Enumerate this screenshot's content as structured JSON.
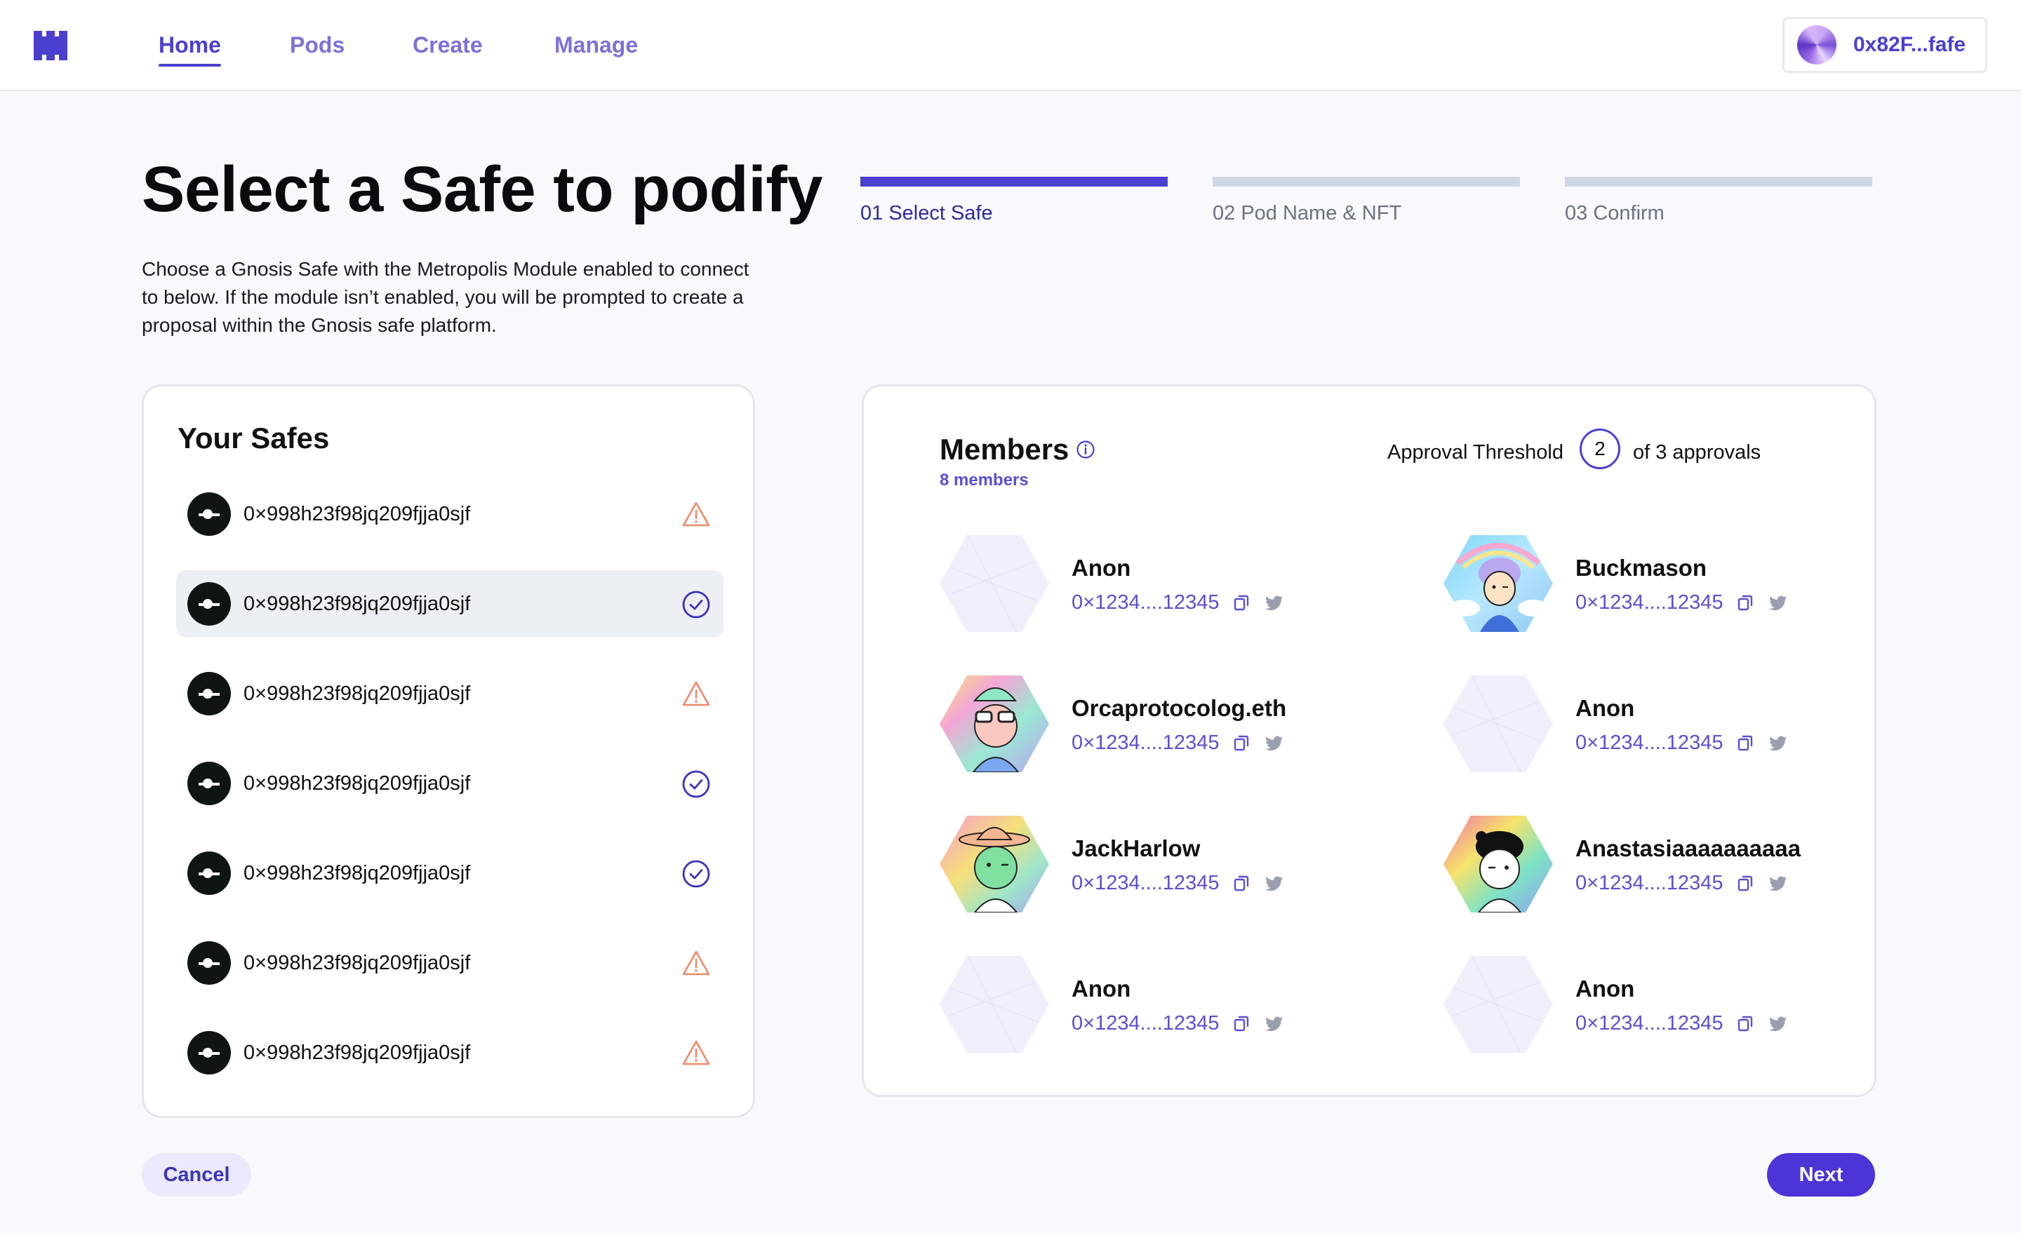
{
  "nav": {
    "items": [
      {
        "label": "Home",
        "active": true
      },
      {
        "label": "Pods",
        "active": false
      },
      {
        "label": "Create",
        "active": false
      },
      {
        "label": "Manage",
        "active": false
      }
    ],
    "wallet": {
      "address": "0x82F...fafe"
    }
  },
  "page": {
    "title": "Select a Safe to podify",
    "description": "Choose a Gnosis Safe with the Metropolis Module enabled to connect to below. If the module isn’t enabled, you will be prompted to create a proposal within the Gnosis safe platform."
  },
  "stepper": {
    "steps": [
      {
        "label": "01 Select Safe",
        "active": true
      },
      {
        "label": "02 Pod Name & NFT",
        "active": false
      },
      {
        "label": "03 Confirm",
        "active": false
      }
    ]
  },
  "safes": {
    "title": "Your Safes",
    "items": [
      {
        "address": "0×998h23f98jq209fjja0sjf",
        "status": "warning-icon",
        "selected": false
      },
      {
        "address": "0×998h23f98jq209fjja0sjf",
        "status": "check-circle-icon",
        "selected": true
      },
      {
        "address": "0×998h23f98jq209fjja0sjf",
        "status": "warning-icon",
        "selected": false
      },
      {
        "address": "0×998h23f98jq209fjja0sjf",
        "status": "check-circle-icon",
        "selected": false
      },
      {
        "address": "0×998h23f98jq209fjja0sjf",
        "status": "check-circle-icon",
        "selected": false
      },
      {
        "address": "0×998h23f98jq209fjja0sjf",
        "status": "warning-icon",
        "selected": false
      },
      {
        "address": "0×998h23f98jq209fjja0sjf",
        "status": "warning-icon",
        "selected": false
      }
    ]
  },
  "members": {
    "title": "Members",
    "count_label": "8 members",
    "threshold": {
      "label": "Approval Threshold",
      "value": "2",
      "suffix": "of 3 approvals"
    },
    "items": [
      {
        "name": "Anon",
        "address": "0×1234....12345",
        "avatar": "anon"
      },
      {
        "name": "Buckmason",
        "address": "0×1234....12345",
        "avatar": "buckmason"
      },
      {
        "name": "Orcaprotocolog.eth",
        "address": "0×1234....12345",
        "avatar": "orca"
      },
      {
        "name": "Anon",
        "address": "0×1234....12345",
        "avatar": "anon"
      },
      {
        "name": "JackHarlow",
        "address": "0×1234....12345",
        "avatar": "jack"
      },
      {
        "name": "Anastasiaaaaaaaaaa",
        "address": "0×1234....12345",
        "avatar": "anastasia"
      },
      {
        "name": "Anon",
        "address": "0×1234....12345",
        "avatar": "anon"
      },
      {
        "name": "Anon",
        "address": "0×1234....12345",
        "avatar": "anon"
      }
    ]
  },
  "footer": {
    "cancel_label": "Cancel",
    "next_label": "Next"
  },
  "colors": {
    "accent": "#4b3fd0",
    "warning": "#f0896b",
    "nav_inactive": "#7d71d8"
  }
}
